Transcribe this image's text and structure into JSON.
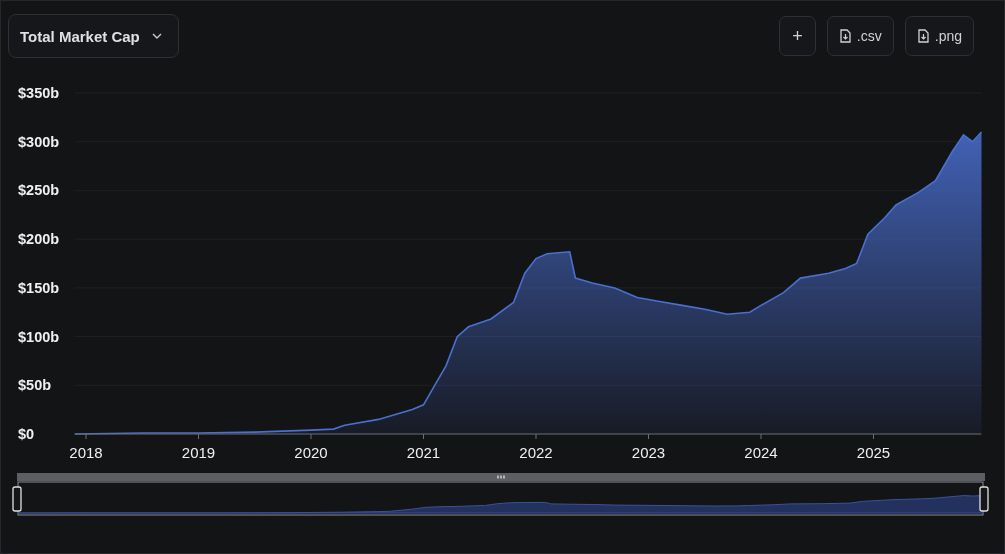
{
  "selector": {
    "label": "Total Market Cap"
  },
  "actions": [
    {
      "kind": "add",
      "label": "+"
    },
    {
      "kind": "download",
      "label": ".csv"
    },
    {
      "kind": "download",
      "label": ".png"
    }
  ],
  "chart_data": {
    "type": "area",
    "x": [
      2017.9,
      2018.5,
      2019,
      2019.5,
      2020,
      2020.2,
      2020.3,
      2020.6,
      2020.9,
      2021,
      2021.1,
      2021.2,
      2021.3,
      2021.4,
      2021.6,
      2021.8,
      2021.9,
      2022,
      2022.1,
      2022.3,
      2022.35,
      2022.5,
      2022.7,
      2022.9,
      2023.1,
      2023.3,
      2023.5,
      2023.7,
      2023.9,
      2024,
      2024.2,
      2024.35,
      2024.6,
      2024.75,
      2024.85,
      2024.95,
      2025.1,
      2025.2,
      2025.4,
      2025.55,
      2025.7,
      2025.8,
      2025.88,
      2025.96
    ],
    "series": [
      {
        "color": "#4a6fd1",
        "values": [
          0,
          1,
          1,
          2,
          4,
          5,
          9,
          15,
          25,
          30,
          50,
          70,
          100,
          110,
          118,
          135,
          165,
          180,
          185,
          187,
          160,
          155,
          150,
          140,
          136,
          132,
          128,
          123,
          125,
          132,
          145,
          160,
          165,
          170,
          175,
          205,
          222,
          235,
          248,
          260,
          290,
          307,
          300,
          310
        ]
      }
    ],
    "xticks": [
      2018,
      2019,
      2020,
      2021,
      2022,
      2023,
      2024,
      2025
    ],
    "yticks": [
      {
        "value": 0,
        "label": "$0"
      },
      {
        "value": 50,
        "label": "$50b"
      },
      {
        "value": 100,
        "label": "$100b"
      },
      {
        "value": 150,
        "label": "$150b"
      },
      {
        "value": 200,
        "label": "$200b"
      },
      {
        "value": 250,
        "label": "$250b"
      },
      {
        "value": 300,
        "label": "$300b"
      },
      {
        "value": 350,
        "label": "$350b"
      }
    ],
    "xlim": [
      2017.9,
      2025.96
    ],
    "ylim": [
      0,
      350
    ],
    "grid": true
  }
}
